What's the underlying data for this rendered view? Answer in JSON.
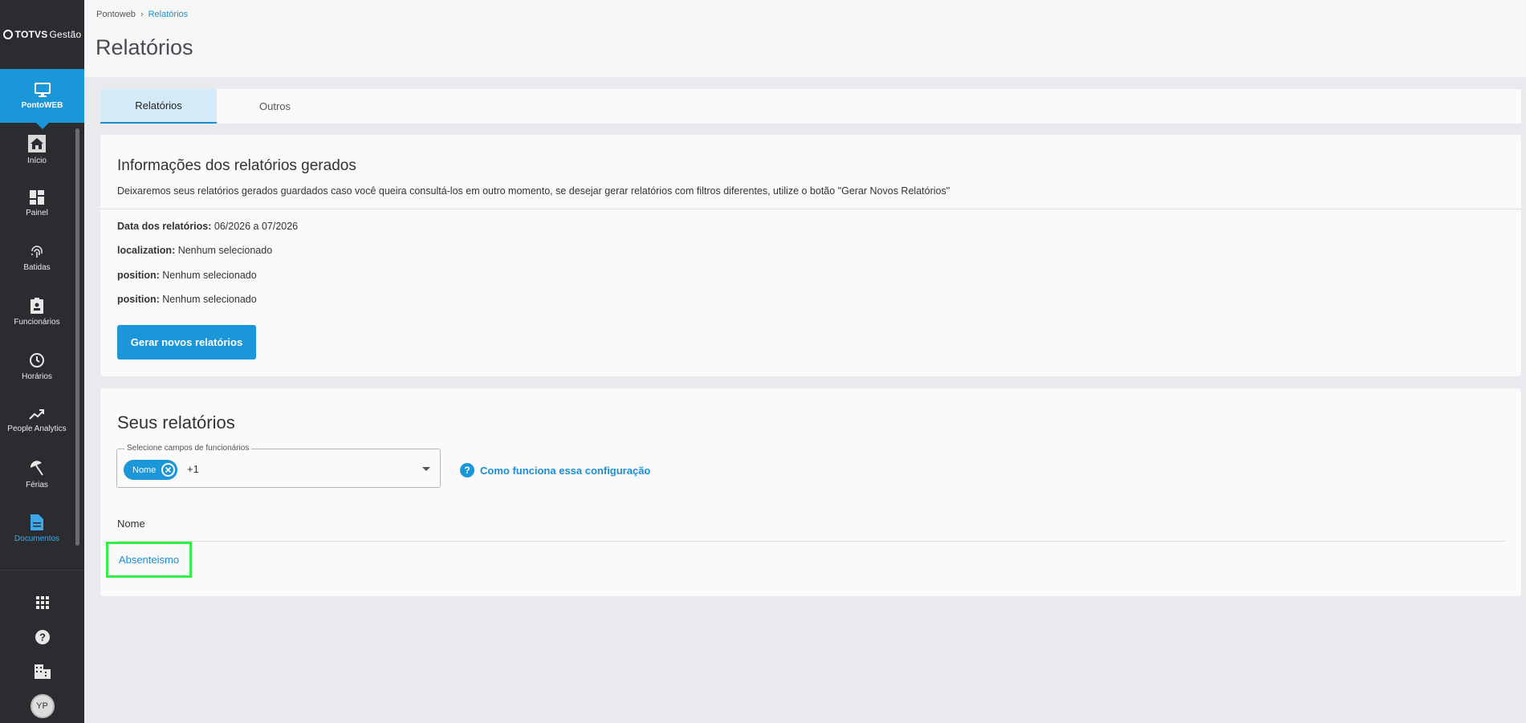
{
  "app": {
    "logo_bold": "TOTVS",
    "logo_light": "Gestão"
  },
  "sidebar": {
    "product": "PontoWEB",
    "items": [
      {
        "label": "Início",
        "icon": "home-icon"
      },
      {
        "label": "Painel",
        "icon": "dashboard-icon"
      },
      {
        "label": "Batidas",
        "icon": "fingerprint-icon"
      },
      {
        "label": "Funcionários",
        "icon": "badge-icon"
      },
      {
        "label": "Horários",
        "icon": "clock-icon"
      },
      {
        "label": "People Analytics",
        "icon": "trend-icon"
      },
      {
        "label": "Férias",
        "icon": "umbrella-icon"
      },
      {
        "label": "Documentos",
        "icon": "document-icon"
      }
    ],
    "bottom_icons": [
      "apps-grid-icon",
      "help-icon",
      "company-icon"
    ],
    "avatar_initials": "YP"
  },
  "breadcrumb": {
    "root": "Pontoweb",
    "current": "Relatórios"
  },
  "page_title": "Relatórios",
  "tabs": [
    {
      "label": "Relatórios",
      "active": true
    },
    {
      "label": "Outros",
      "active": false
    }
  ],
  "info_card": {
    "title": "Informações dos relatórios gerados",
    "description": "Deixaremos seus relatórios gerados guardados caso você queira consultá-los em outro momento, se desejar gerar relatórios com filtros diferentes, utilize o botão \"Gerar Novos Relatórios\"",
    "rows": [
      {
        "label": "Data dos relatórios:",
        "value": " 06/2026 a 07/2026"
      },
      {
        "label": "localization:",
        "value": " Nenhum selecionado"
      },
      {
        "label": "position:",
        "value": " Nenhum selecionado"
      },
      {
        "label": "position:",
        "value": " Nenhum selecionado"
      }
    ],
    "button_label": "Gerar novos relatórios"
  },
  "reports_card": {
    "title": "Seus relatórios",
    "select": {
      "legend": "Selecione campos de funcionários",
      "chip": "Nome",
      "more": "+1"
    },
    "help_link": "Como funciona essa configuração",
    "column_header": "Nome",
    "rows": [
      "Absenteismo"
    ]
  },
  "colors": {
    "sidebar_bg": "#2b2c30",
    "primary": "#1b96d8",
    "highlight": "#33ee44"
  }
}
